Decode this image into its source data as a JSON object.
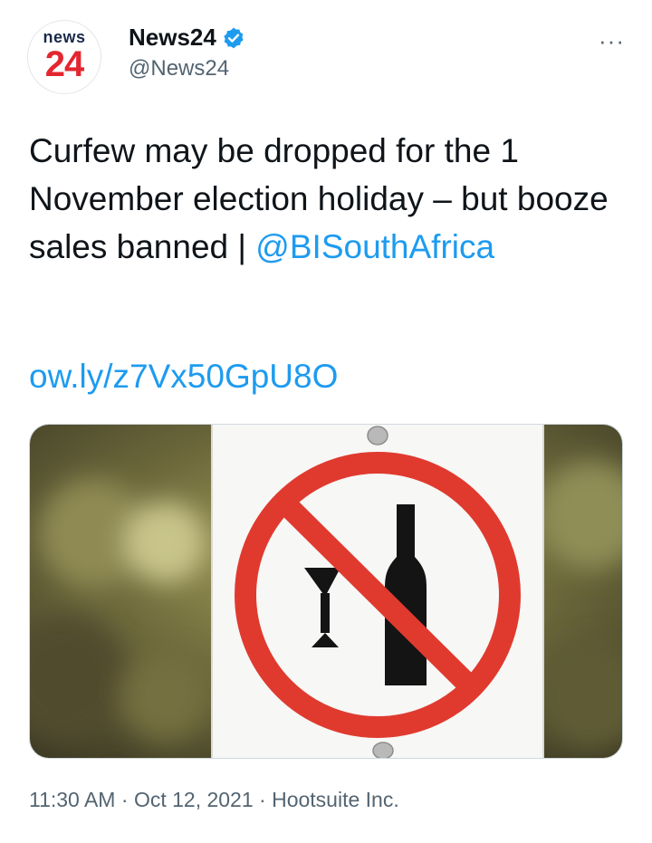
{
  "account": {
    "avatar_top": "news",
    "avatar_bottom": "24",
    "name": "News24",
    "handle": "@News24",
    "verified": true,
    "verified_color": "#1d9bf0"
  },
  "more_icon": "···",
  "tweet": {
    "text": "Curfew may be dropped for the 1 November election holiday – but booze sales banned | ",
    "mention": "@BISouthAfrica",
    "link": "ow.ly/z7Vx50GpU8O"
  },
  "media": {
    "icon": "no-alcohol-sign",
    "sign_color": "#e03a2f"
  },
  "meta": {
    "time": "11:30 AM",
    "date": "Oct 12, 2021",
    "separator": "·",
    "source": "Hootsuite Inc."
  },
  "colors": {
    "link": "#1d9bf0",
    "secondary": "#536471"
  }
}
